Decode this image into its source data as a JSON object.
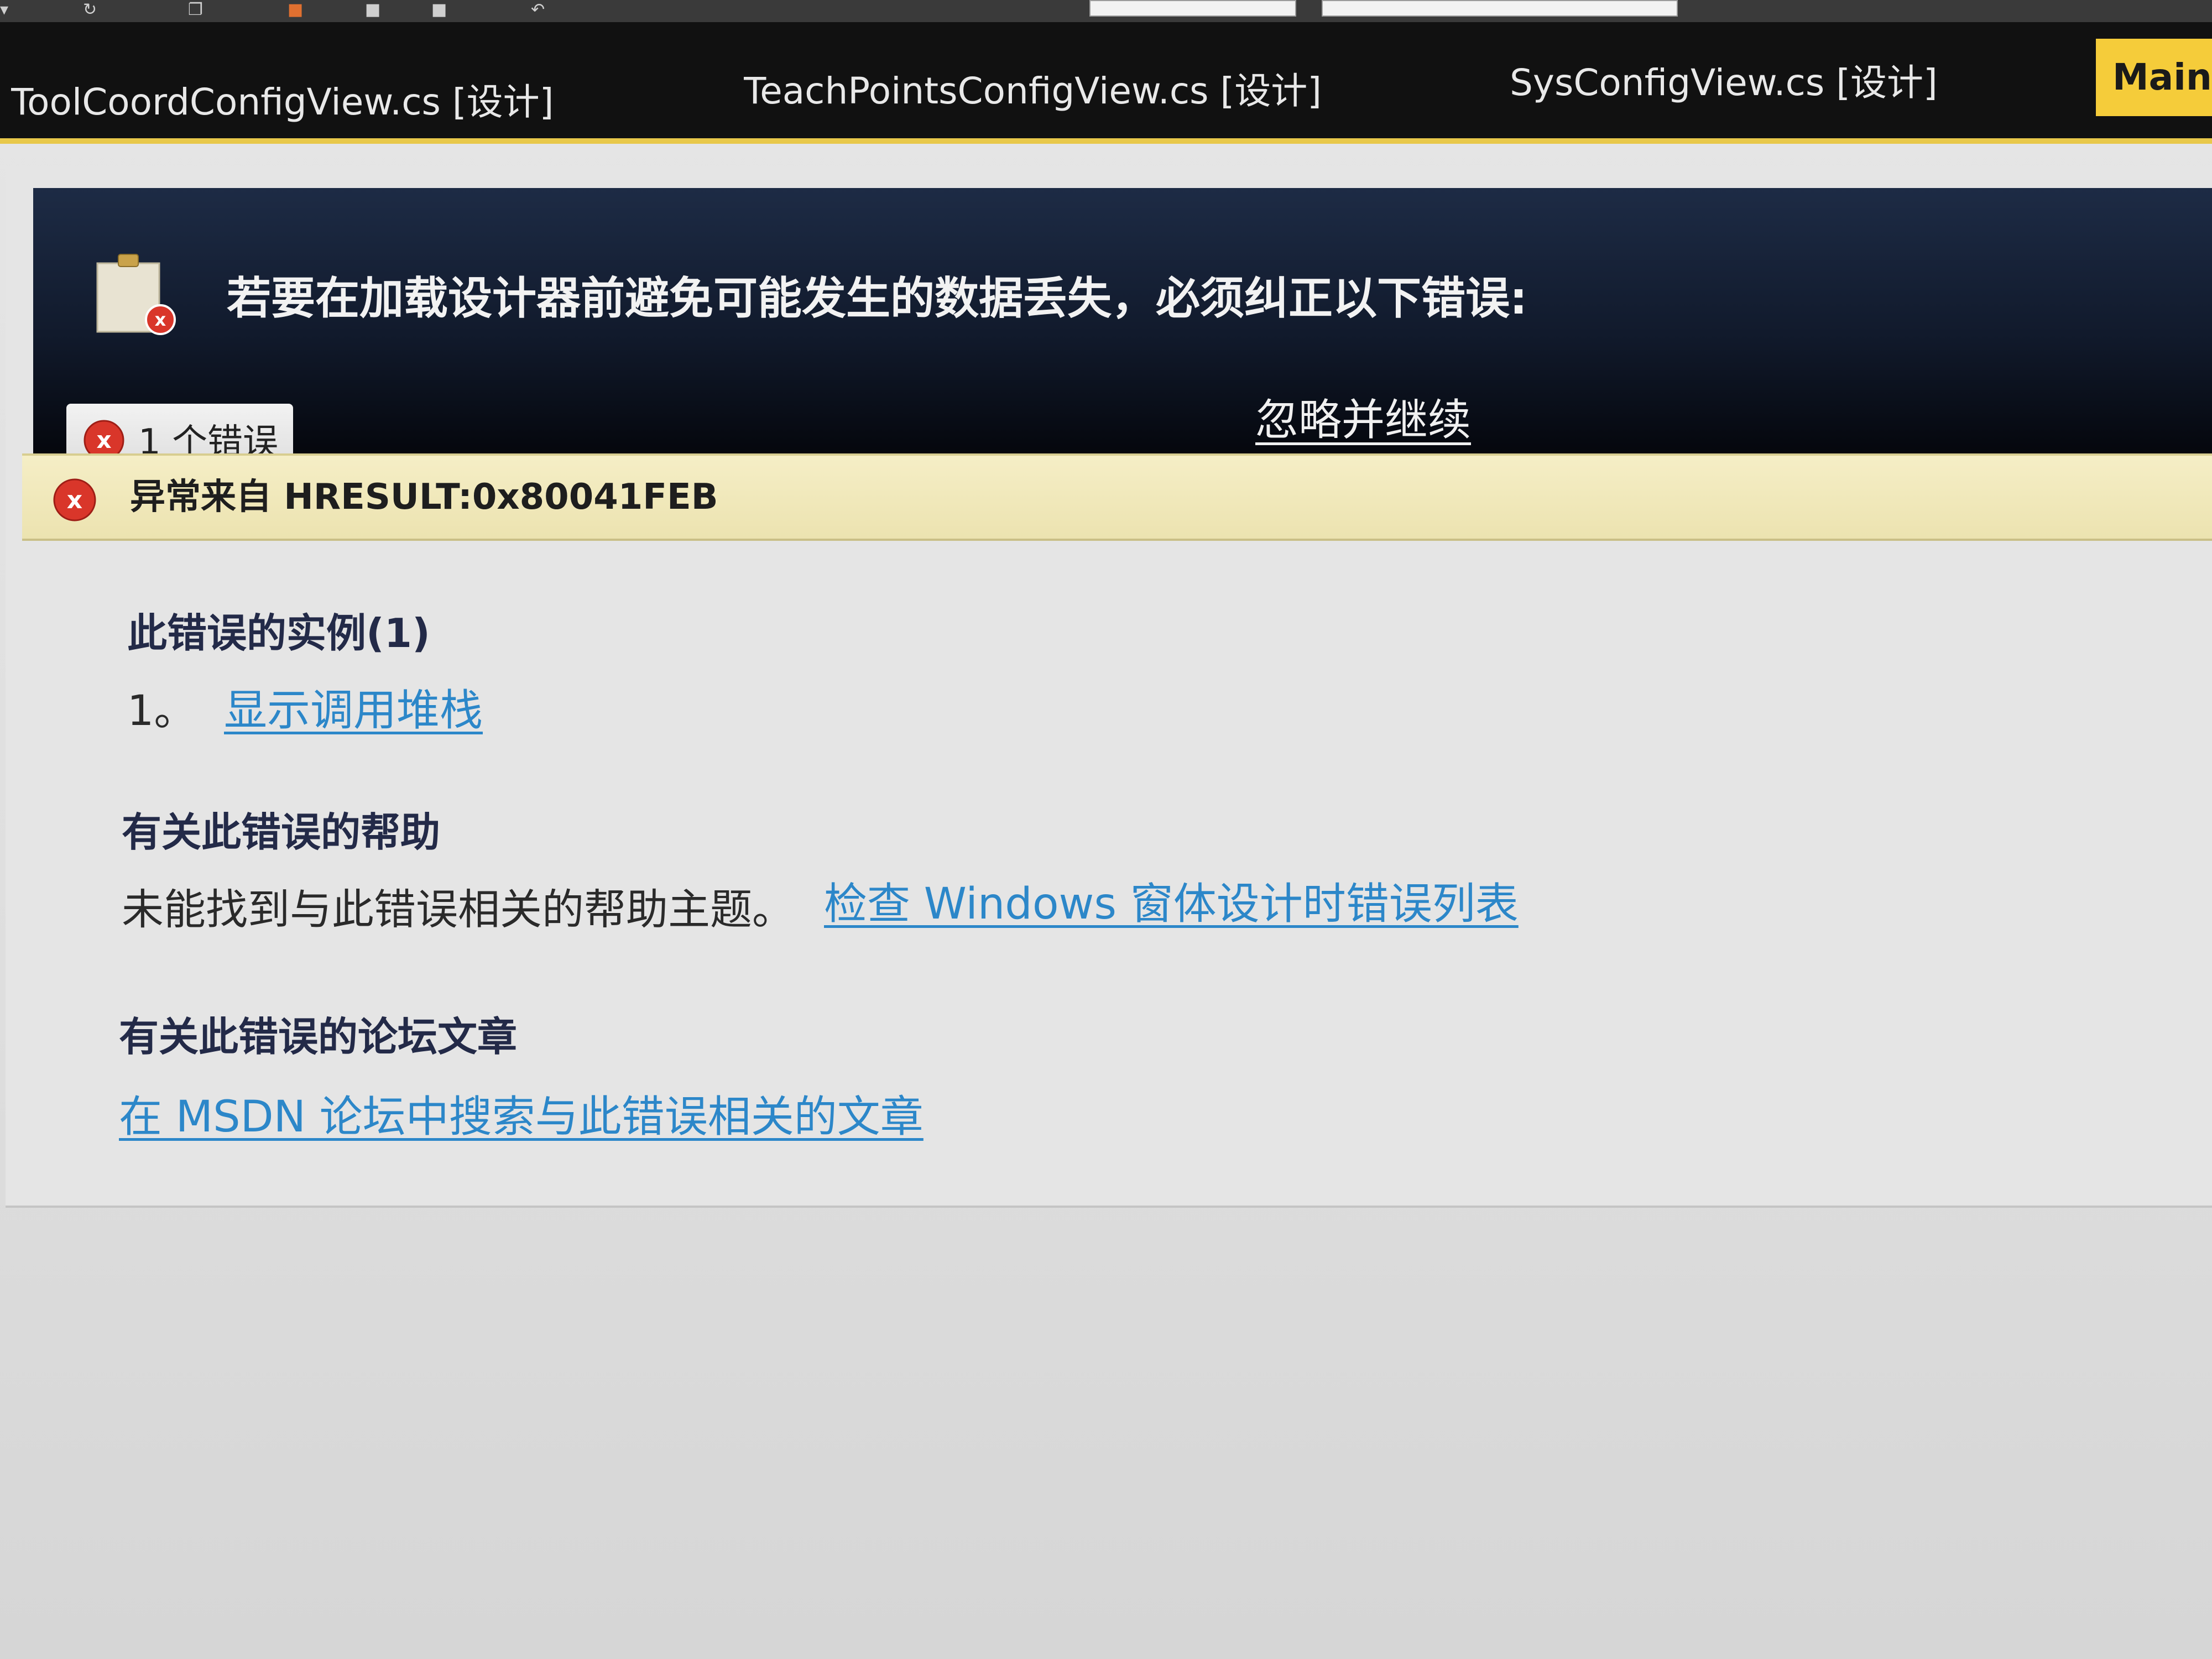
{
  "tabs": [
    {
      "label": "ToolCoordConfigView.cs [设计]",
      "active": false
    },
    {
      "label": "TeachPointsConfigView.cs [设计]",
      "active": false
    },
    {
      "label": "SysConfigView.cs [设计]",
      "active": false
    },
    {
      "label": "MainV",
      "active": true
    }
  ],
  "banner": {
    "message": "若要在加载设计器前避免可能发生的数据丢失，必须纠正以下错误:",
    "ignore_link": "忽略并继续",
    "error_tab_label": "1 个错误"
  },
  "error": {
    "title": "异常来自 HRESULT:0x80041FEB"
  },
  "instances": {
    "heading": "此错误的实例(1)",
    "items": [
      {
        "number": "1。",
        "link": "显示调用堆栈"
      }
    ]
  },
  "help": {
    "heading": "有关此错误的帮助",
    "text": "未能找到与此错误相关的帮助主题。",
    "link": "检查 Windows 窗体设计时错误列表"
  },
  "forum": {
    "heading": "有关此错误的论坛文章",
    "link": "在 MSDN 论坛中搜索与此错误相关的文章"
  },
  "colors": {
    "banner": "#111a2c",
    "active_tab": "#f5cc3a",
    "error_row": "#f1e9bd",
    "link": "#2c87c9",
    "error_icon": "#d9362a"
  }
}
